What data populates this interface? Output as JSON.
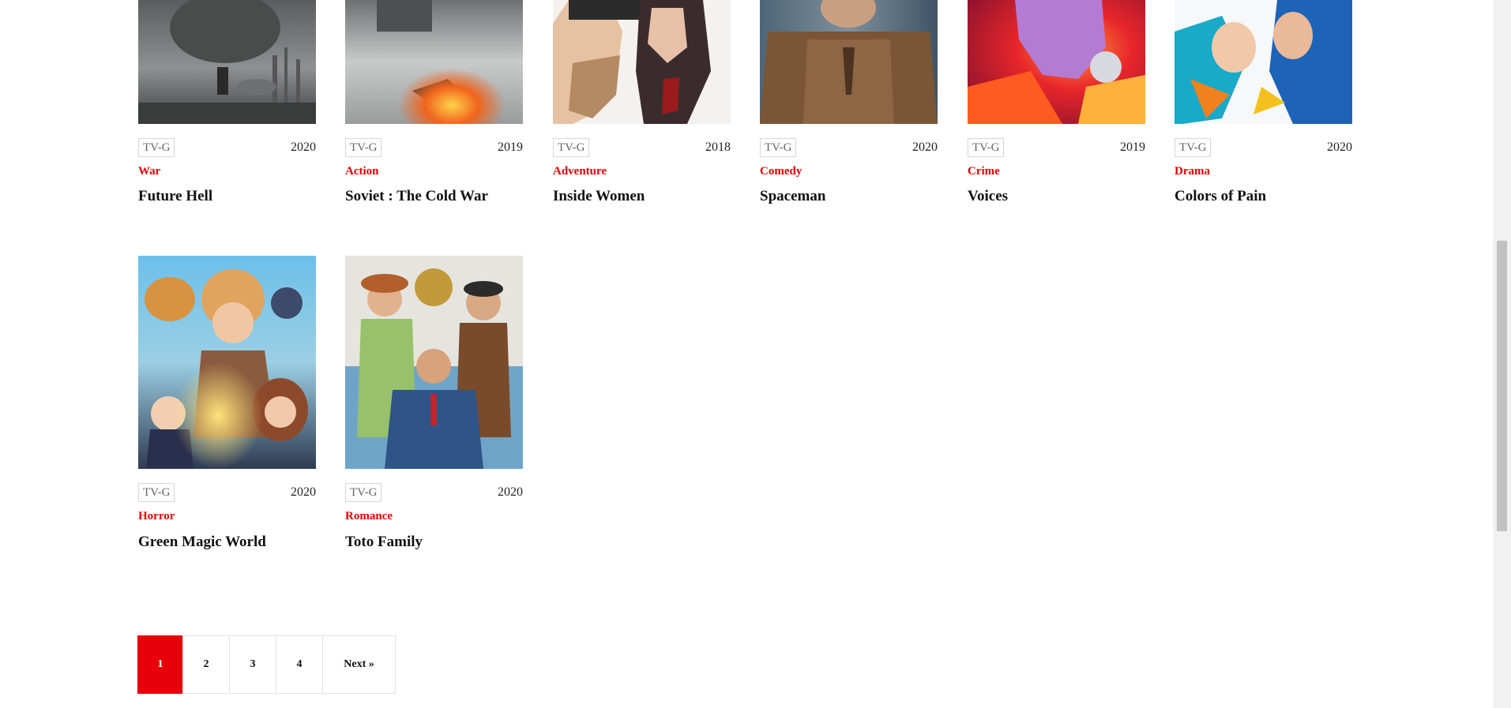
{
  "colors": {
    "accent": "#e8000a",
    "genre": "#e00000"
  },
  "movies": [
    {
      "rating": "TV-G",
      "year": "2020",
      "genre": "War",
      "title": "Future Hell",
      "poster": "future-hell-poster"
    },
    {
      "rating": "TV-G",
      "year": "2019",
      "genre": "Action",
      "title": "Soviet : The Cold War",
      "poster": "soviet-cold-war-poster"
    },
    {
      "rating": "TV-G",
      "year": "2018",
      "genre": "Adventure",
      "title": "Inside Women",
      "poster": "inside-women-poster"
    },
    {
      "rating": "TV-G",
      "year": "2020",
      "genre": "Comedy",
      "title": "Spaceman",
      "poster": "spaceman-poster"
    },
    {
      "rating": "TV-G",
      "year": "2019",
      "genre": "Crime",
      "title": "Voices",
      "poster": "voices-poster"
    },
    {
      "rating": "TV-G",
      "year": "2020",
      "genre": "Drama",
      "title": "Colors of Pain",
      "poster": "colors-of-pain-poster"
    },
    {
      "rating": "TV-G",
      "year": "2020",
      "genre": "Horror",
      "title": "Green Magic World",
      "poster": "green-magic-world-poster"
    },
    {
      "rating": "TV-G",
      "year": "2020",
      "genre": "Romance",
      "title": "Toto Family",
      "poster": "toto-family-poster"
    }
  ],
  "pagination": {
    "pages": [
      "1",
      "2",
      "3",
      "4"
    ],
    "current": "1",
    "next_label": "Next »"
  }
}
